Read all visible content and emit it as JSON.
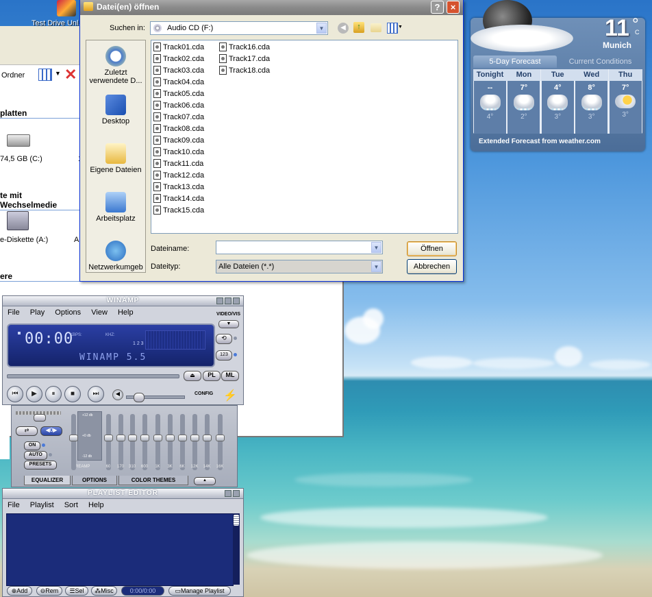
{
  "explorer": {
    "desktop_icon_label": "Test Drive Unl...",
    "toolbar_folders_label": "Ordner",
    "section_hard_disks": "platten",
    "drive_c_label": "74,5 GB (C:)",
    "section_removable": "te mit Wechselmedie",
    "floppy_label": "e-Diskette (A:)",
    "floppy_extra": "A",
    "section_other": "ere",
    "drive_c_extra": "1"
  },
  "dialog": {
    "title": "Datei(en) öffnen",
    "help_button": "?",
    "close_button": "×",
    "look_in_label": "Suchen in:",
    "look_in_value": "Audio CD (F:)",
    "places": [
      {
        "label": "Zuletzt verwendete D...",
        "icon": "recent-icon"
      },
      {
        "label": "Desktop",
        "icon": "desktop-icon"
      },
      {
        "label": "Eigene Dateien",
        "icon": "my-documents-icon"
      },
      {
        "label": "Arbeitsplatz",
        "icon": "my-computer-icon"
      },
      {
        "label": "Netzwerkumgeb",
        "icon": "network-icon"
      }
    ],
    "files": [
      "Track01.cda",
      "Track02.cda",
      "Track03.cda",
      "Track04.cda",
      "Track05.cda",
      "Track06.cda",
      "Track07.cda",
      "Track08.cda",
      "Track09.cda",
      "Track10.cda",
      "Track11.cda",
      "Track12.cda",
      "Track13.cda",
      "Track14.cda",
      "Track15.cda",
      "Track16.cda",
      "Track17.cda",
      "Track18.cda"
    ],
    "filename_label": "Dateiname:",
    "filename_value": "",
    "filetype_label": "Dateityp:",
    "filetype_value": "Alle Dateien (*.*)",
    "open_button": "Öffnen",
    "cancel_button": "Abbrechen"
  },
  "weather": {
    "temperature": "11",
    "unit": "°",
    "unit_c": "C",
    "city": "Munich",
    "tab_forecast": "5-Day Forecast",
    "tab_current": "Current Conditions",
    "days": [
      {
        "name": "Tonight",
        "high": "--",
        "low": "4°",
        "icon": "rain-cloud-icon"
      },
      {
        "name": "Mon",
        "high": "7°",
        "low": "2°",
        "icon": "rain-cloud-icon"
      },
      {
        "name": "Tue",
        "high": "4°",
        "low": "3°",
        "icon": "rain-cloud-icon"
      },
      {
        "name": "Wed",
        "high": "8°",
        "low": "3°",
        "icon": "rain-cloud-icon"
      },
      {
        "name": "Thu",
        "high": "7°",
        "low": "3°",
        "icon": "partly-sunny-icon"
      }
    ],
    "footer": "Extended Forecast from weather.com"
  },
  "winamp": {
    "title": "WINAMP",
    "menu": [
      "File",
      "Play",
      "Options",
      "View",
      "Help"
    ],
    "video_vis": "VIDEO/VIS",
    "time": "00:00",
    "kbps": "KBPS:",
    "khz": "KHZ:",
    "display_text": "WINAMP 5.5",
    "pl_button": "PL",
    "ml_button": "ML",
    "config": "CONFIG",
    "counter": "1 2 3"
  },
  "equalizer": {
    "on": "ON",
    "auto": "AUTO",
    "presets": "PRESETS",
    "db_top": "+12 db",
    "db_mid": "+0 db",
    "db_bot": "-12 db",
    "preamp": "PREAMP",
    "bands": [
      "60",
      "170",
      "310",
      "600",
      "1K",
      "3K",
      "6K",
      "12K",
      "14K",
      "16K"
    ],
    "tab_eq": "EQUALIZER",
    "tab_options": "OPTIONS",
    "tab_themes": "COLOR THEMES"
  },
  "playlist": {
    "title": "PLAYLIST EDITOR",
    "menu": [
      "File",
      "Playlist",
      "Sort",
      "Help"
    ],
    "add": "Add",
    "rem": "Rem",
    "sel": "Sel",
    "misc": "Misc",
    "time": "0:00/0:00",
    "manage": "Manage Playlist"
  },
  "colors": {
    "xp_blue": "#0831d9",
    "winamp_display": "#1b2c7a",
    "weather_panel": "#5e7ea8"
  }
}
